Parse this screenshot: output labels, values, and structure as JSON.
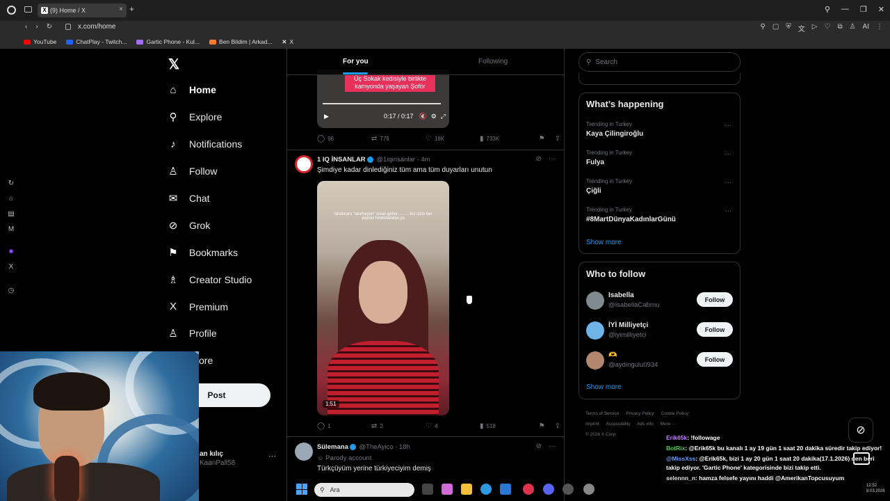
{
  "browser": {
    "tab_title": "(9) Home / X",
    "url": "x.com/home",
    "bookmarks": [
      {
        "label": "YouTube",
        "color": "#ff0000"
      },
      {
        "label": "ChatPlay - Twitch...",
        "color": "#1e63ff"
      },
      {
        "label": "Gartic Phone - Kul...",
        "color": "#a66bff"
      },
      {
        "label": "Ben Bildim | Arkad...",
        "color": "#ff7b2f"
      },
      {
        "label": "X",
        "color": "#ffffff"
      }
    ]
  },
  "x_nav": {
    "items": [
      {
        "label": "Home",
        "icon": "home-icon",
        "glyph": "⌂"
      },
      {
        "label": "Explore",
        "icon": "search-icon",
        "glyph": "⚲"
      },
      {
        "label": "Notifications",
        "icon": "bell-icon",
        "glyph": "🔔"
      },
      {
        "label": "Follow",
        "icon": "person-plus-icon",
        "glyph": "👤"
      },
      {
        "label": "Chat",
        "icon": "mail-icon",
        "glyph": "✉"
      },
      {
        "label": "Grok",
        "icon": "grok-icon",
        "glyph": "⊘"
      },
      {
        "label": "Bookmarks",
        "icon": "bookmark-icon",
        "glyph": "🔖"
      },
      {
        "label": "Creator Studio",
        "icon": "creator-icon",
        "glyph": "♙"
      },
      {
        "label": "Premium",
        "icon": "x-icon",
        "glyph": "X"
      },
      {
        "label": "Profile",
        "icon": "profile-icon",
        "glyph": "👤"
      }
    ],
    "more_partial": "ore",
    "post_label": "Post",
    "account_name_partial": "an kılıç",
    "account_handle_partial": "KaanPall58"
  },
  "feed": {
    "tabs": {
      "active": "For you",
      "inactive": "Following"
    },
    "tweet1": {
      "media_text": "Üç Sokak kedisiyle birlikte kamyonda yaşayan Şoför",
      "time": "0:17 / 0:17",
      "replies": "96",
      "reposts": "779",
      "likes": "18K",
      "views": "733K"
    },
    "tweet2": {
      "name": "1 IQ İNSANLAR",
      "handle": "@1iqinsanlar",
      "time": "· 4m",
      "text": "Şimdiye kadar dinlediğiniz tüm ama tüm duyarları unutun",
      "media_caption": "hindistanı \"sevmeyen\" clean girller.......... kız sizin her şeyiniz hindistandan ya",
      "duration": "1:51",
      "replies": "1",
      "reposts": "2",
      "likes": "4",
      "views": "518"
    },
    "tweet3": {
      "name": "Sülemana",
      "handle": "@TheAyico",
      "time": "· 18h",
      "badge": "Parody account",
      "text": "Türkçüyüm yerine türkiyeciyim demiş"
    }
  },
  "sidebar": {
    "search_placeholder": "Search",
    "trending_title": "What’s happening",
    "trends": [
      {
        "context": "Trending in Turkey",
        "name": "Kaya Çilingiroğlu"
      },
      {
        "context": "Trending in Turkey",
        "name": "Fulya"
      },
      {
        "context": "Trending in Turkey",
        "name": "Çiğli"
      },
      {
        "context": "Trending in Turkey",
        "name": "#8MartDünyaKadınlarGünü"
      }
    ],
    "show_more": "Show more",
    "wtf_title": "Who to follow",
    "wtf": [
      {
        "name": "Isabella",
        "handle": "@IsabellaCabrnu"
      },
      {
        "name": "İYİ Milliyetçi",
        "handle": "@iyimilliyetci"
      },
      {
        "name": "🫶",
        "handle": "@aydingulu0934"
      }
    ],
    "follow_label": "Follow",
    "footer": [
      "Terms of Service",
      "Privacy Policy",
      "Cookie Policy",
      "Imprint",
      "Accessibility",
      "Ads info",
      "More ···",
      "© 2026 X Corp."
    ]
  },
  "chat": [
    {
      "user": "Erik65k",
      "msg": ": !followage"
    },
    {
      "user": "BotRix",
      "msg": ": @Erik65k bu kanalı 1 ay 19 gün 1 saat 20 dakika süredir takip ediyor!"
    },
    {
      "user": "@MissXss",
      "msg": ": @Erik65k, bizi 1 ay 20 gün 1 saat 20 dakika(17.1.2026) den beri takip ediyor. 'Gartic Phone' kategorisinde bizi takip etti."
    },
    {
      "user": "selennn_n",
      "msg": ": hamza felsefe yayını haddi @AmerikanTopcusuyum"
    }
  ],
  "taskbar": {
    "search_label": "Ara",
    "time": "12:52",
    "date": "8.03.2026"
  },
  "colors": {
    "accent": "#1d9bf0",
    "background": "#000000",
    "border": "#2f3336",
    "muted_text": "#71767b"
  }
}
